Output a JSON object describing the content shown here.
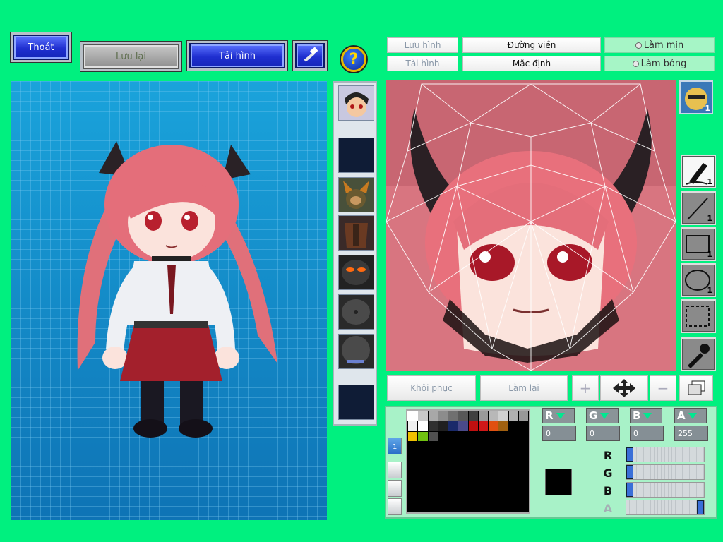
{
  "top_bar": {
    "exit_label": "Thoát",
    "save_label": "Lưu lại",
    "load_label": "Tải hình",
    "help_glyph": "?"
  },
  "editor_tabs": {
    "save_image": "Lưu hình",
    "load_image": "Tải hình",
    "outline": "Đường viền",
    "default": "Mặc định",
    "smooth": "Làm mịn",
    "shade": "Làm bóng"
  },
  "tools": {
    "face_count": "1",
    "pen_count": "1",
    "line_count": "1",
    "rect_count": "1",
    "ellipse_count": "1"
  },
  "bottom_actions": {
    "restore": "Khôi phục",
    "redo": "Làm lại"
  },
  "color": {
    "channels": [
      {
        "label": "R",
        "value": "0"
      },
      {
        "label": "G",
        "value": "0"
      },
      {
        "label": "B",
        "value": "0"
      },
      {
        "label": "A",
        "value": "255"
      }
    ],
    "sliders": [
      {
        "label": "R",
        "fraction": 0.0
      },
      {
        "label": "G",
        "fraction": 0.0
      },
      {
        "label": "B",
        "fraction": 0.0
      },
      {
        "label": "A",
        "fraction": 1.0
      }
    ],
    "current_color": "#000000",
    "side_tab_label": "1",
    "swatches": [
      "#ffffff",
      "#c8c8c8",
      "#a8a8a8",
      "#8c8c8c",
      "#707070",
      "#585858",
      "#404040",
      "#9a9a9a",
      "#b8b8b8",
      "#d0d0d0",
      "#b0b0b0",
      "#989898",
      "#f0f0f0",
      "#ffffff",
      "#303030",
      "#202020",
      "#1a2a6a",
      "#4a4a8a",
      "#c01010",
      "#d01818",
      "#e05010",
      "#a06010",
      "#000000",
      "#000000",
      "#f0c000",
      "#70c010",
      "#505050"
    ]
  },
  "palette_colors": {
    "background": "#00f07f",
    "accent_blue": "#1f2fd0",
    "panel_green": "#a8f2c8"
  }
}
